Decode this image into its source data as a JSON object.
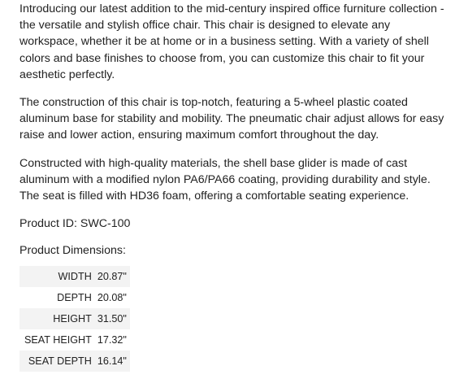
{
  "description": {
    "paragraph_1": "Introducing our latest addition to the mid-century inspired office furniture collection - the versatile and stylish office chair. This chair is designed to elevate any workspace, whether it be at home or in a business setting. With a variety of shell colors and base finishes to choose from, you can customize this chair to fit your aesthetic perfectly.",
    "paragraph_2": "The construction of this chair is top-notch, featuring a 5-wheel plastic coated aluminum base for stability and mobility. The pneumatic chair adjust allows for easy raise and lower action, ensuring maximum comfort throughout the day.",
    "paragraph_3": "Constructed with high-quality materials, the shell base glider is made of cast aluminum with a modified nylon PA6/PA66 coating, providing durability and style. The seat is filled with HD36 foam, offering a comfortable seating experience."
  },
  "product": {
    "id_label": "Product ID: SWC-100",
    "dimensions_label": "Product Dimensions:",
    "dimensions": [
      {
        "label": "WIDTH",
        "value": "20.87\""
      },
      {
        "label": "DEPTH",
        "value": "20.08\""
      },
      {
        "label": "HEIGHT",
        "value": "31.50\""
      },
      {
        "label": "SEAT HEIGHT",
        "value": "17.32\""
      },
      {
        "label": "SEAT DEPTH",
        "value": "16.14\""
      }
    ]
  }
}
